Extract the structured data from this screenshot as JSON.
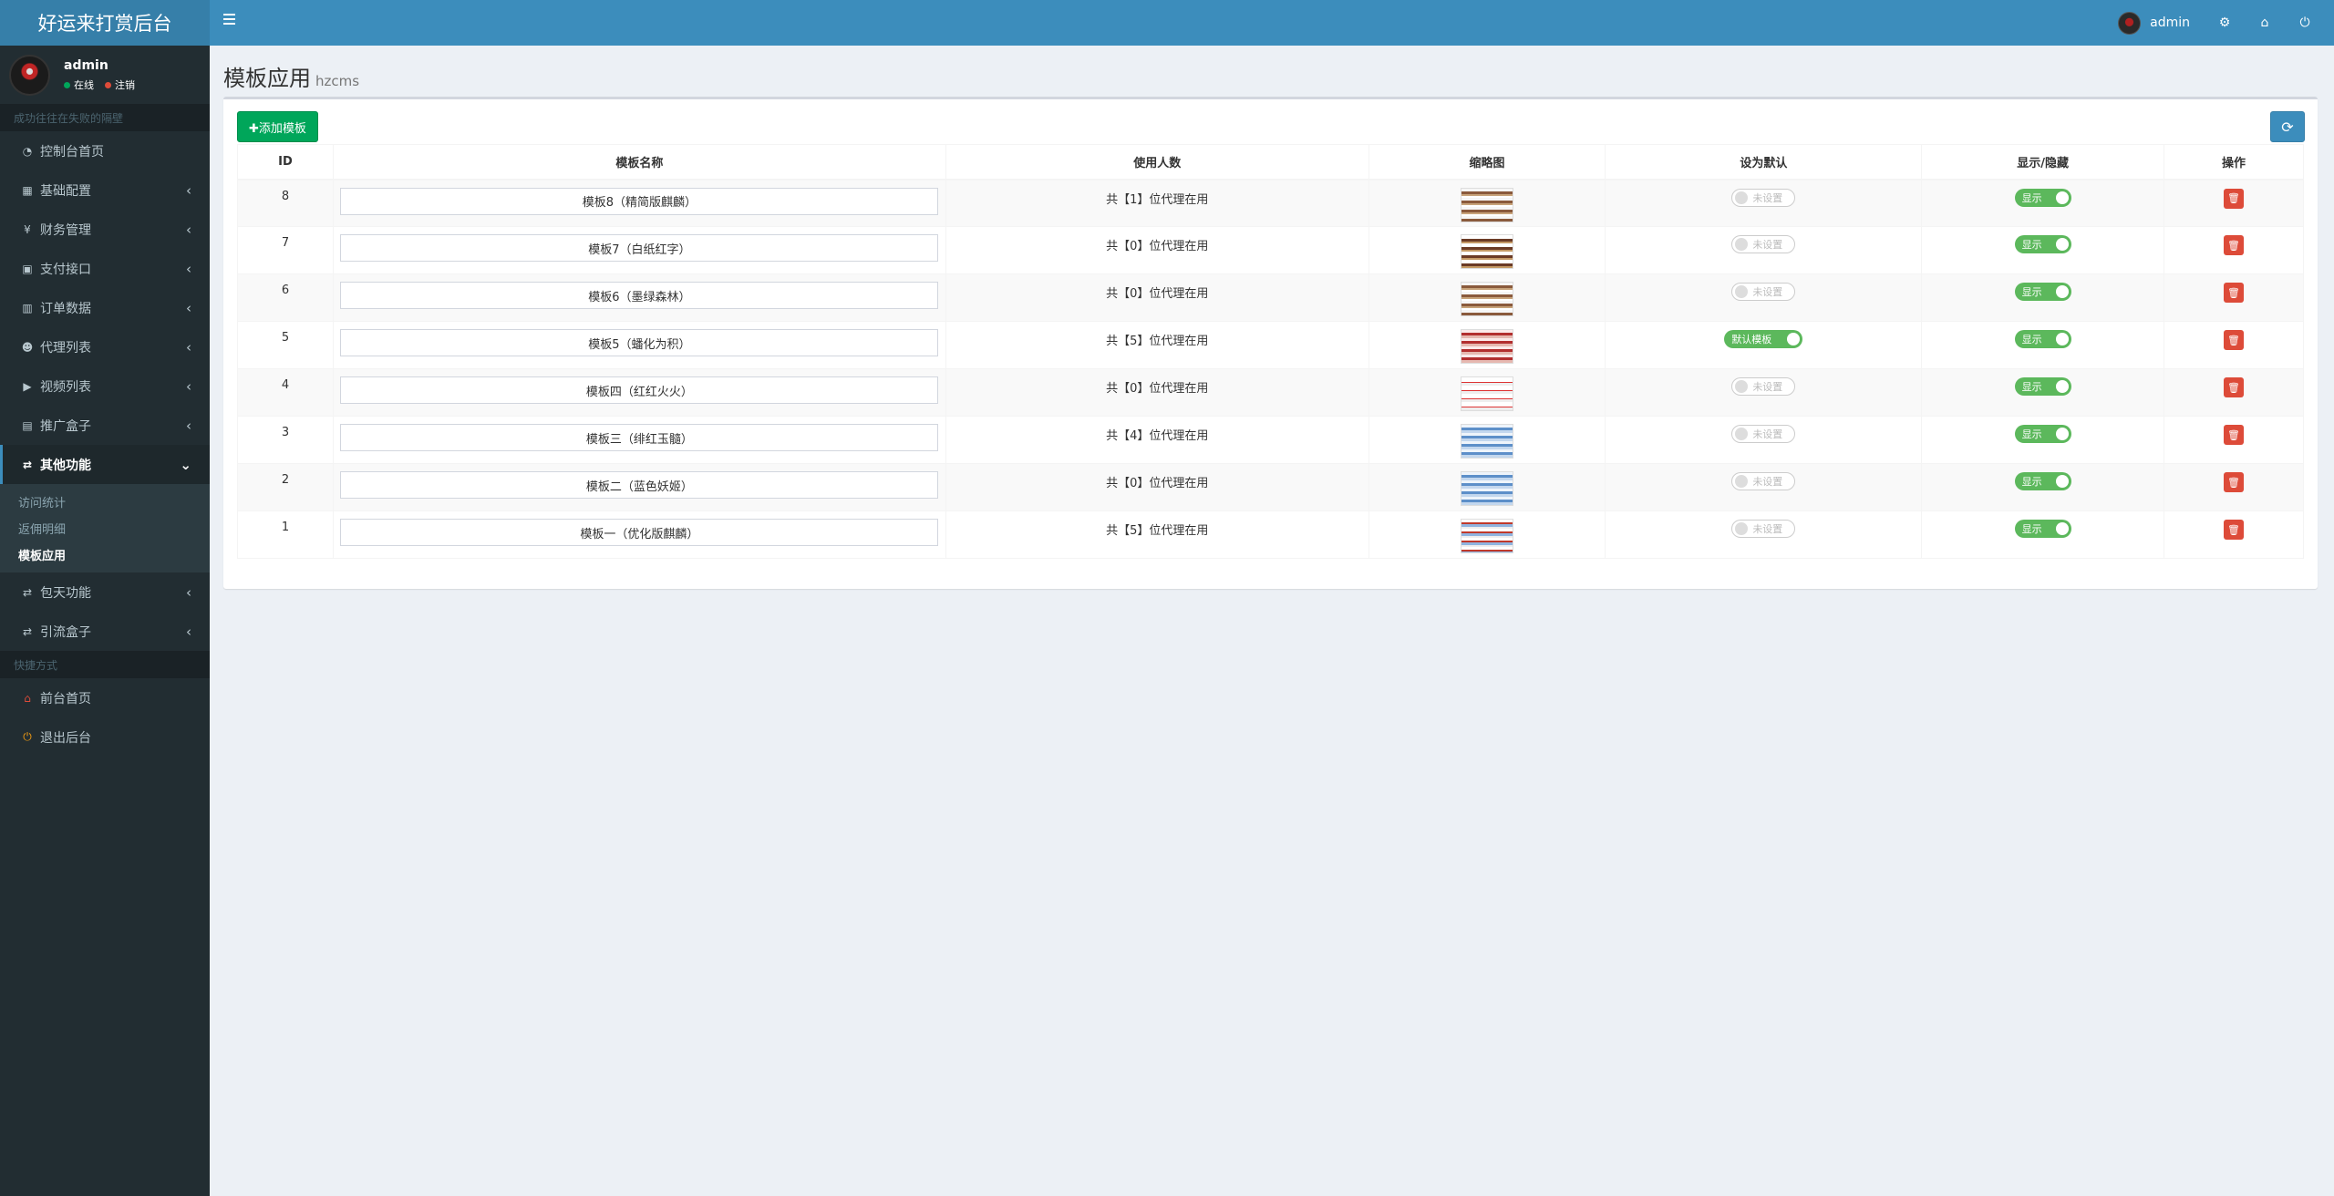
{
  "app": {
    "title": "好运来打赏后台"
  },
  "topbar": {
    "username": "admin"
  },
  "sidebar": {
    "user": {
      "name": "admin",
      "online": "在线",
      "logout": "注销"
    },
    "section1": "成功往往在失败的隔壁",
    "items": [
      {
        "label": "控制台首页",
        "icon": "dashboard-icon"
      },
      {
        "label": "基础配置",
        "icon": "grid-icon"
      },
      {
        "label": "财务管理",
        "icon": "yen-icon"
      },
      {
        "label": "支付接口",
        "icon": "payment-icon"
      },
      {
        "label": "订单数据",
        "icon": "bar-chart-icon"
      },
      {
        "label": "代理列表",
        "icon": "users-icon"
      },
      {
        "label": "视频列表",
        "icon": "video-icon"
      },
      {
        "label": "推广盒子",
        "icon": "table-icon"
      },
      {
        "label": "其他功能",
        "icon": "retweet-icon"
      }
    ],
    "subitems": [
      "访问统计",
      "返佣明细",
      "模板应用"
    ],
    "items2": [
      {
        "label": "包天功能",
        "icon": "retweet-icon"
      },
      {
        "label": "引流盒子",
        "icon": "retweet-icon"
      }
    ],
    "section2": "快捷方式",
    "shortcuts": [
      {
        "label": "前台首页",
        "icon": "home-icon"
      },
      {
        "label": "退出后台",
        "icon": "power-icon"
      }
    ]
  },
  "page": {
    "title": "模板应用",
    "subtitle": "hzcms"
  },
  "toolbar": {
    "add_label": "✚添加模板"
  },
  "table": {
    "headers": [
      "ID",
      "模板名称",
      "使用人数",
      "缩略图",
      "设为默认",
      "显示/隐藏",
      "操作"
    ],
    "rows": [
      {
        "id": "8",
        "name": "模板8（精简版麒麟）",
        "users": "共【1】位代理在用",
        "default": "未设置",
        "visible": "显示"
      },
      {
        "id": "7",
        "name": "模板7（白纸红字）",
        "users": "共【0】位代理在用",
        "default": "未设置",
        "visible": "显示"
      },
      {
        "id": "6",
        "name": "模板6（墨绿森林）",
        "users": "共【0】位代理在用",
        "default": "未设置",
        "visible": "显示"
      },
      {
        "id": "5",
        "name": "模板5（蟠化为积）",
        "users": "共【5】位代理在用",
        "default": "默认模板",
        "visible": "显示"
      },
      {
        "id": "4",
        "name": "模板四（红红火火）",
        "users": "共【0】位代理在用",
        "default": "未设置",
        "visible": "显示"
      },
      {
        "id": "3",
        "name": "模板三（绯红玉髓）",
        "users": "共【4】位代理在用",
        "default": "未设置",
        "visible": "显示"
      },
      {
        "id": "2",
        "name": "模板二（蓝色妖姬）",
        "users": "共【0】位代理在用",
        "default": "未设置",
        "visible": "显示"
      },
      {
        "id": "1",
        "name": "模板一（优化版麒麟）",
        "users": "共【5】位代理在用",
        "default": "未设置",
        "visible": "显示"
      }
    ]
  },
  "colors": {
    "header": "#3c8dbc",
    "logo": "#367fa9",
    "sidebar": "#222d32",
    "success": "#00a65a",
    "danger": "#dd4b39",
    "toggle_on": "#5cb85c"
  }
}
